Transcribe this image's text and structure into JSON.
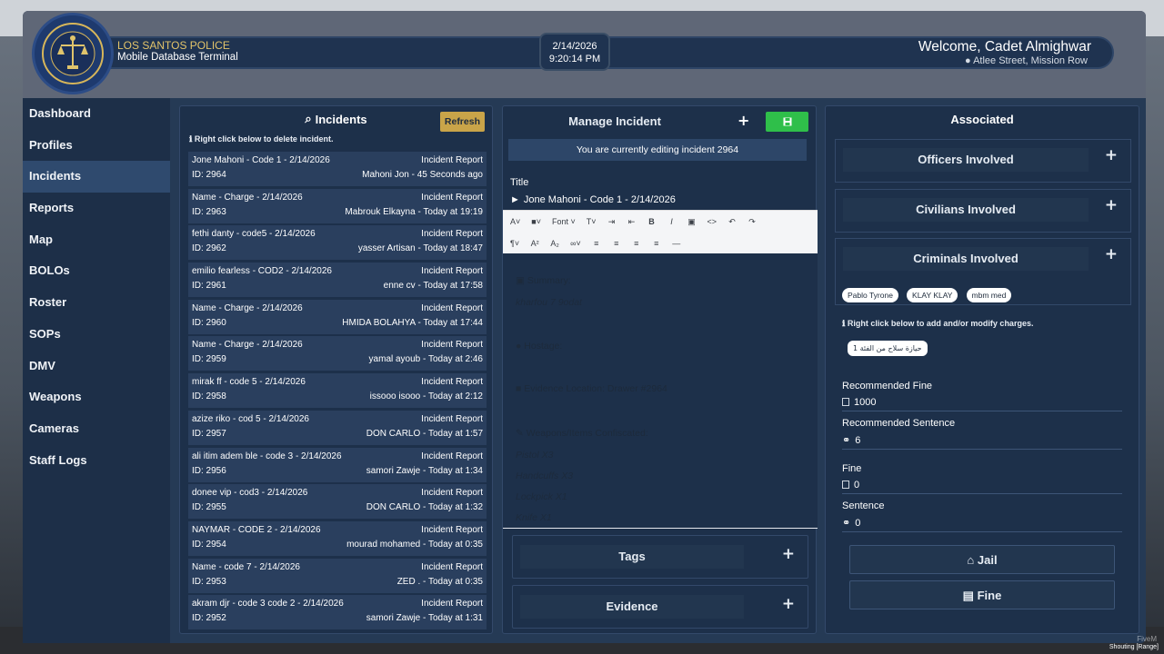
{
  "header": {
    "dept_name": "LOS SANTOS POLICE",
    "dept_sub": "Mobile Database Terminal",
    "date": "2/14/2026",
    "time": "9:20:14 PM",
    "welcome": "Welcome, Cadet Almighwar",
    "location": "Atlee Street, Mission Row"
  },
  "sidebar": {
    "items": [
      {
        "label": "Dashboard"
      },
      {
        "label": "Profiles"
      },
      {
        "label": "Incidents"
      },
      {
        "label": "Reports"
      },
      {
        "label": "Map"
      },
      {
        "label": "BOLOs"
      },
      {
        "label": "Roster"
      },
      {
        "label": "SOPs"
      },
      {
        "label": "DMV"
      },
      {
        "label": "Weapons"
      },
      {
        "label": "Cameras"
      },
      {
        "label": "Staff Logs"
      }
    ],
    "active": "Incidents"
  },
  "incidents": {
    "title": "Incidents",
    "refresh_label": "Refresh",
    "hint": "Right click below to delete incident.",
    "rows": [
      {
        "title": "Jone Mahoni - Code 1 - 2/14/2026",
        "type": "Incident Report",
        "id": "ID: 2964",
        "meta": "Mahoni Jon - 45 Seconds ago"
      },
      {
        "title": "Name - Charge - 2/14/2026",
        "type": "Incident Report",
        "id": "ID: 2963",
        "meta": "Mabrouk Elkayna - Today at 19:19"
      },
      {
        "title": "fethi danty - code5 - 2/14/2026",
        "type": "Incident Report",
        "id": "ID: 2962",
        "meta": "yasser Artisan - Today at 18:47"
      },
      {
        "title": "emilio fearless - COD2 - 2/14/2026",
        "type": "Incident Report",
        "id": "ID: 2961",
        "meta": "enne cv - Today at 17:58"
      },
      {
        "title": "Name - Charge - 2/14/2026",
        "type": "Incident Report",
        "id": "ID: 2960",
        "meta": "HMIDA BOLAHYA - Today at 17:44"
      },
      {
        "title": "Name - Charge - 2/14/2026",
        "type": "Incident Report",
        "id": "ID: 2959",
        "meta": "yamal ayoub - Today at 2:46"
      },
      {
        "title": "mirak ff - code 5 - 2/14/2026",
        "type": "Incident Report",
        "id": "ID: 2958",
        "meta": "issooo isooo - Today at 2:12"
      },
      {
        "title": "azize riko - cod 5 - 2/14/2026",
        "type": "Incident Report",
        "id": "ID: 2957",
        "meta": "DON CARLO - Today at 1:57"
      },
      {
        "title": "ali itim adem ble - code 3 - 2/14/2026",
        "type": "Incident Report",
        "id": "ID: 2956",
        "meta": "samori Zawje - Today at 1:34"
      },
      {
        "title": "donee vip - cod3 - 2/14/2026",
        "type": "Incident Report",
        "id": "ID: 2955",
        "meta": "DON CARLO - Today at 1:32"
      },
      {
        "title": "NAYMAR - CODE 2 - 2/14/2026",
        "type": "Incident Report",
        "id": "ID: 2954",
        "meta": "mourad mohamed - Today at 0:35"
      },
      {
        "title": "Name - code 7 - 2/14/2026",
        "type": "Incident Report",
        "id": "ID: 2953",
        "meta": "ZED . - Today at 0:35"
      },
      {
        "title": "akram djr - code 3 code 2 - 2/14/2026",
        "type": "Incident Report",
        "id": "ID: 2952",
        "meta": "samori Zawje - Today at 1:31"
      }
    ]
  },
  "manage": {
    "title": "Manage Incident",
    "plus": "+",
    "banner": "You are currently editing incident 2964",
    "title_label": "Title",
    "title_value": "Jone Mahoni - Code 1 - 2/14/2026",
    "toolbar_font": "Font",
    "editor": {
      "summary_label": "Summary:",
      "summary_value": "kharfou 7 9odat",
      "hostage_label": "Hostage:",
      "evidence_label": "Evidence Location:",
      "evidence_value": "Drawer #2964",
      "weapons_label": "Weapons/Items Confiscated:",
      "items": [
        "Pistol X3",
        "Handcuffs X3",
        "Lockpick X1",
        "Knife X1"
      ]
    },
    "tags_label": "Tags",
    "evidence_label": "Evidence"
  },
  "associated": {
    "title": "Associated",
    "officers_label": "Officers Involved",
    "civilians_label": "Civilians Involved",
    "criminals_label": "Criminals Involved",
    "criminals": [
      "Pablo Tyrone",
      "KLAY KLAY",
      "mbm med"
    ],
    "hint": "Right click below to add and/or modify charges.",
    "charge": "حيازة سلاح من الفئة 1",
    "recommended_fine_label": "Recommended Fine",
    "recommended_fine": "1000",
    "recommended_sentence_label": "Recommended Sentence",
    "recommended_sentence": "6",
    "fine_label": "Fine",
    "fine": "0",
    "sentence_label": "Sentence",
    "sentence": "0",
    "jail_button": "Jail",
    "fine_button": "Fine"
  },
  "overlay": {
    "status": "Shouting [Range]",
    "watermark": "FiveM"
  },
  "colors": {
    "accent_gold": "#c9a449",
    "save_green": "#2fbf4a",
    "panel_bg": "#1d304a",
    "header_gold": "#e3c46a"
  }
}
